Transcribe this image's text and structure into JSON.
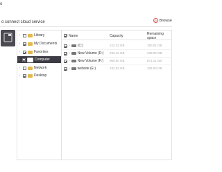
{
  "header": {
    "title_fragment": "o",
    "subtitle": "o connect cloud service",
    "browse_label": "Browse",
    "browse_icon": "clock-icon"
  },
  "device": {
    "icon": "computer-icon"
  },
  "tree": [
    {
      "label": "Library",
      "checked": false,
      "icon": "folder-icon"
    },
    {
      "label": "My Documents",
      "checked": true,
      "icon": "folder-icon"
    },
    {
      "label": "Favorites",
      "checked": true,
      "icon": "folder-icon"
    },
    {
      "label": "Computer",
      "checked": true,
      "icon": "computer-icon",
      "selected": true
    },
    {
      "label": "Network",
      "checked": false,
      "icon": "folder-icon"
    },
    {
      "label": "Desktop",
      "checked": true,
      "icon": "folder-icon"
    }
  ],
  "table": {
    "columns": {
      "name": "Name",
      "capacity": "Capacity",
      "remaining": "Remaining space"
    },
    "rows": [
      {
        "name": "(C:)",
        "capacity": "222.22 GB",
        "remaining": "150.01 GB"
      },
      {
        "name": "New Volume (D:)",
        "capacity": "232.42 GB",
        "remaining": "230.00 GB"
      },
      {
        "name": "New Volume (F:)",
        "capacity": "900.00 GB",
        "remaining": "871.11 GB"
      },
      {
        "name": "website (E:)",
        "capacity": "232.93 GB",
        "remaining": "229.00 GB"
      }
    ]
  },
  "colors": {
    "selected_bg": "#3c3c44",
    "folder": "#e3b94c",
    "accent_red": "#d9534f"
  }
}
